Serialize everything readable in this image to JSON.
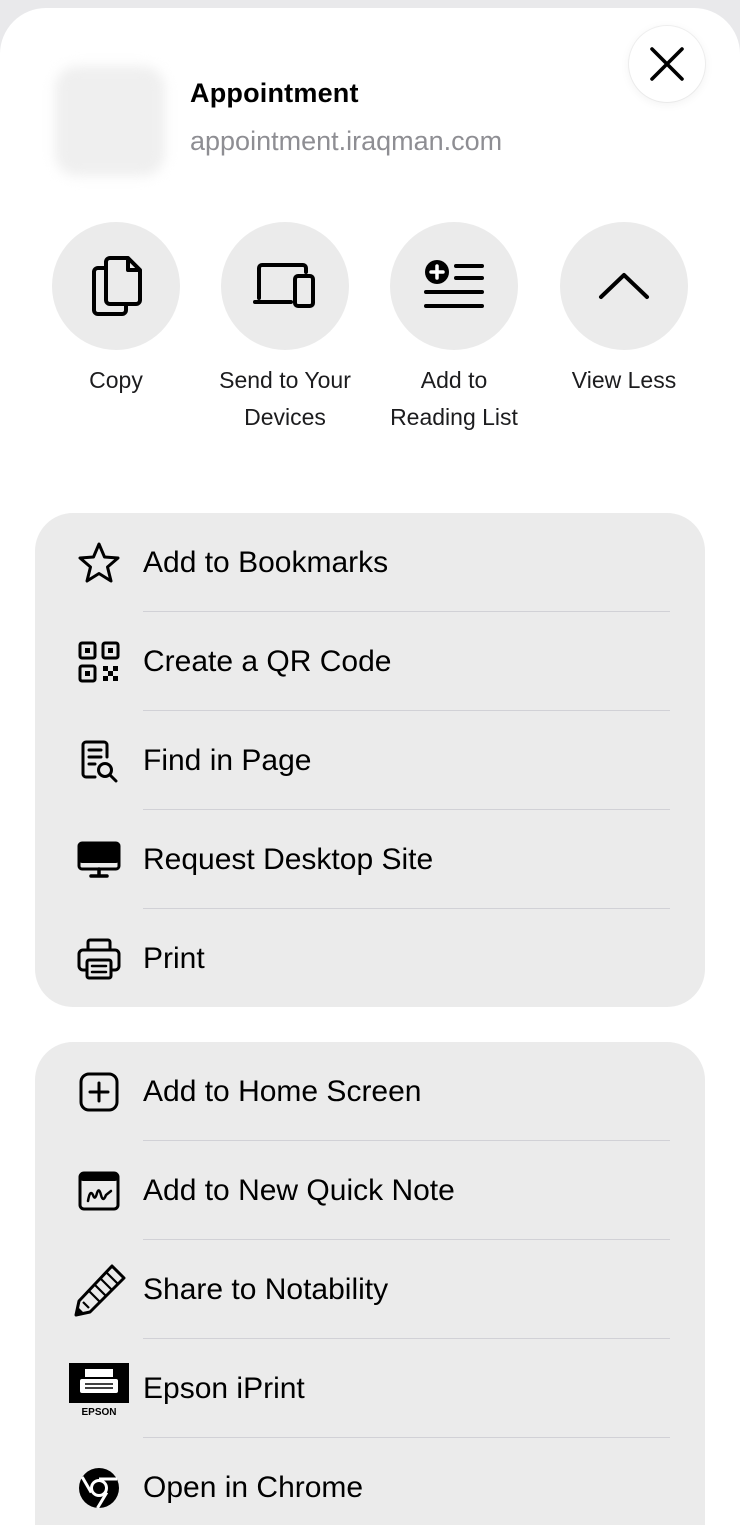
{
  "header": {
    "title": "Appointment",
    "url": "appointment.iraqman.com",
    "close_icon": "close-icon"
  },
  "actions": [
    {
      "label": "Copy",
      "icon": "copy-icon"
    },
    {
      "label": "Send to Your Devices",
      "icon": "devices-icon"
    },
    {
      "label": "Add to Reading List",
      "icon": "reading-list-icon"
    },
    {
      "label": "View Less",
      "icon": "chevron-up-icon"
    }
  ],
  "group1": [
    {
      "label": "Add to Bookmarks",
      "icon": "star-icon"
    },
    {
      "label": "Create a QR Code",
      "icon": "qr-code-icon"
    },
    {
      "label": "Find in Page",
      "icon": "find-in-page-icon"
    },
    {
      "label": "Request Desktop Site",
      "icon": "desktop-icon"
    },
    {
      "label": "Print",
      "icon": "printer-icon"
    }
  ],
  "group2": [
    {
      "label": "Add to Home Screen",
      "icon": "add-square-icon"
    },
    {
      "label": "Add to New Quick Note",
      "icon": "quick-note-icon"
    },
    {
      "label": "Share to Notability",
      "icon": "pencil-icon"
    },
    {
      "label": "Epson iPrint",
      "icon": "epson-logo-icon",
      "icon_text": "EPSON"
    },
    {
      "label": "Open in Chrome",
      "icon": "chrome-icon"
    }
  ],
  "colors": {
    "background": "#e9e9eb",
    "sheet": "#ffffff",
    "group": "#ebebeb",
    "secondary_text": "#8e8e93",
    "separator": "#d1d1d6"
  }
}
